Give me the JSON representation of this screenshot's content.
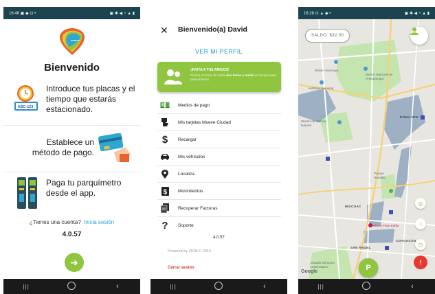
{
  "status_left_1": "16:46 ▣ ◆ ⊡ •",
  "status_right_1": "▣ ✱ ◀ ◔ ▲ ▮",
  "status_left_3": "16:28 ⊡ ▲ ◆ •",
  "status_right_3": "▣ ✱ ◀ ◔ ▲ ▮",
  "nav": {
    "recent": "|||",
    "home": "",
    "back": "‹"
  },
  "onboarding": {
    "title": "Bienvenido",
    "steps": [
      {
        "text": "Introduce tus placas y el tiempo que estarás estacionado.",
        "icon": "clock-plate-icon",
        "plate": "ABC-123"
      },
      {
        "text": "Establece un método de pago.",
        "icon": "credit-card-icon"
      },
      {
        "text": "Paga tu parquímetro desde el app.",
        "icon": "parking-meter-icon"
      }
    ],
    "account_prompt": "¿Tienes una cuenta?",
    "login_link": "Inicia sesión",
    "version": "4.0.57",
    "next_icon": "arrow-right-icon",
    "colors": {
      "accent": "#8FC53F",
      "link": "#2AA6CF",
      "statusbar": "#1B4350"
    }
  },
  "menu": {
    "greeting": "Bienvenido(a) David",
    "close_icon": "close-icon",
    "profile_link": "VER MI PERFIL",
    "invite": {
      "title": "¡INVITA A TUS AMIGOS!",
      "body_start": "Recibe un bono de hasta",
      "body_bold": "dos horas y media",
      "body_end": "en tiempo para parquímetros.",
      "icon": "people-icon"
    },
    "items": [
      {
        "label": "Medios de pago",
        "icon": "money-icon"
      },
      {
        "label": "Mis tarjetas Mueve Ciudad",
        "icon": "card-hand-icon"
      },
      {
        "label": "Recargar",
        "icon": "dollar-icon"
      },
      {
        "label": "Mis vehículos",
        "icon": "car-icon"
      },
      {
        "label": "Localiza",
        "icon": "map-pin-icon"
      },
      {
        "label": "Movimientos",
        "icon": "dollar-box-icon"
      },
      {
        "label": "Recuperar Facturas",
        "icon": "receipt-icon"
      },
      {
        "label": "Soporte",
        "icon": "question-icon"
      }
    ],
    "version": "4.0.57",
    "powered_by": "Powered by ZION © 2019",
    "logout": "Cerrar sesión",
    "colors": {
      "link": "#26A0C9",
      "banner": "#8FC53F",
      "logout": "#D63B30"
    }
  },
  "map": {
    "balance": "SALDO: $32.00",
    "user_icon": "user-icon",
    "park_button": "P",
    "labels": [
      {
        "text": "Museo Soumaya"
      },
      {
        "text": "Museo Nacional de Antropología"
      },
      {
        "text": "Auditorio Nacional"
      },
      {
        "text": "ROMA NTE."
      },
      {
        "text": "Museo de Historia Natural"
      },
      {
        "text": "Parque Hundido"
      },
      {
        "text": "MIXCOAC"
      },
      {
        "text": "Museo Frida Kahlo"
      },
      {
        "text": "COYOACÁN"
      },
      {
        "text": "Estadio Olímpico Universitario"
      },
      {
        "text": "SAN ÁNGEL"
      }
    ],
    "google": "Google",
    "side_buttons": [
      "locate-icon",
      "bell-icon",
      "clock-icon"
    ],
    "alert_icon": "alert-icon",
    "colors": {
      "zone": "#8FA6BE",
      "green_space": "#C5E5B0",
      "road": "#FFFFFF",
      "highway": "#F6D277",
      "alert": "#E53935"
    }
  }
}
